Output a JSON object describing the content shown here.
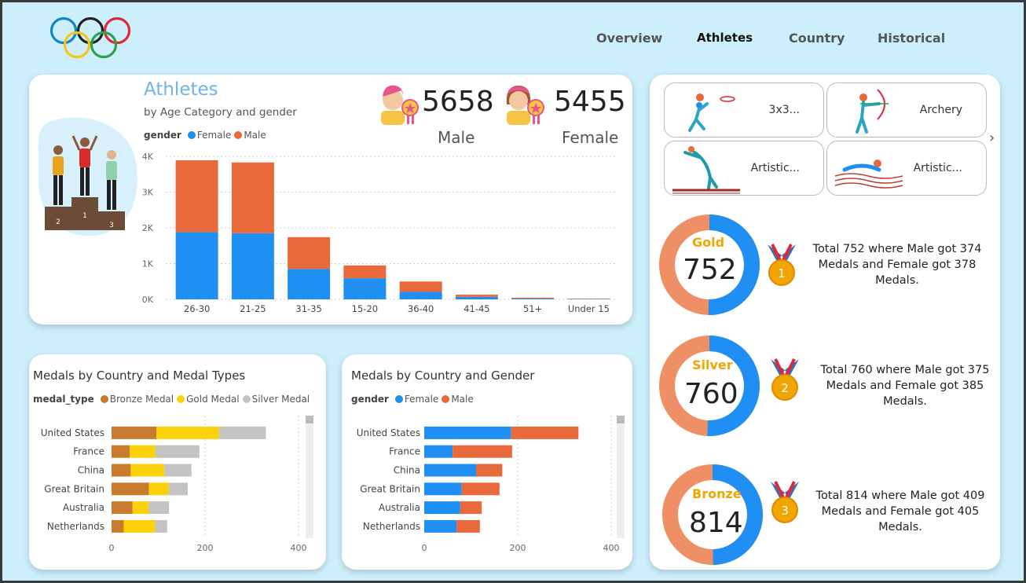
{
  "nav": {
    "items": [
      "Overview",
      "Athletes",
      "Country",
      "Historical"
    ],
    "active": "Athletes"
  },
  "athletes": {
    "title": "Athletes",
    "subtitle": "by Age Category and gender",
    "male_count": "5658",
    "male_label": "Male",
    "female_count": "5455",
    "female_label": "Female"
  },
  "sports": [
    {
      "label": "3x3...",
      "icon": "basketball-icon"
    },
    {
      "label": "Archery",
      "icon": "archery-icon"
    },
    {
      "label": "Artistic...",
      "icon": "gymnastics-icon"
    },
    {
      "label": "Artistic...",
      "icon": "swimming-icon"
    }
  ],
  "medals": [
    {
      "name": "Gold",
      "total": "752",
      "male": 374,
      "female": 378,
      "text": "Total 752 where Male got 374 Medals and Female got 378 Medals.",
      "label_color": "#f0a500"
    },
    {
      "name": "Silver",
      "total": "760",
      "male": 375,
      "female": 385,
      "text": "Total 760 where Male got 375 Medals and Female got 385 Medals.",
      "label_color": "#f0a500"
    },
    {
      "name": "Bronze",
      "total": "814",
      "male": 409,
      "female": 405,
      "text": "Total 814 where Male got 409 Medals and Female got 405 Medals.",
      "label_color": "#f0a500"
    }
  ],
  "colors": {
    "female": "#1f8ff3",
    "male": "#e8693a",
    "ring_male": "#ef8f66",
    "bronze": "#c97a2c",
    "gold": "#fdd20a",
    "silver": "#c3c3c3"
  },
  "chart_data": [
    {
      "type": "bar",
      "stacked": true,
      "title": "",
      "legend_title": "gender",
      "categories": [
        "26-30",
        "21-25",
        "31-35",
        "15-20",
        "36-40",
        "41-45",
        "51+",
        "Under 15"
      ],
      "series": [
        {
          "name": "Female",
          "values": [
            1880,
            1850,
            850,
            590,
            210,
            70,
            20,
            10
          ]
        },
        {
          "name": "Male",
          "values": [
            2010,
            1980,
            890,
            360,
            290,
            60,
            25,
            10
          ]
        }
      ],
      "ylim": [
        0,
        4000
      ],
      "yticks": [
        "0K",
        "1K",
        "2K",
        "3K",
        "4K"
      ],
      "grid": true,
      "legend_position": "top-left"
    },
    {
      "type": "bar",
      "orientation": "horizontal",
      "stacked": true,
      "title": "Medals by Country and Medal Types",
      "legend_title": "medal_type",
      "categories": [
        "United States",
        "France",
        "China",
        "Great Britain",
        "Australia",
        "Netherlands"
      ],
      "series": [
        {
          "name": "Bronze Medal",
          "values": [
            96,
            39,
            41,
            80,
            45,
            26
          ]
        },
        {
          "name": "Gold Medal",
          "values": [
            134,
            55,
            72,
            42,
            34,
            67
          ]
        },
        {
          "name": "Silver Medal",
          "values": [
            100,
            94,
            58,
            41,
            44,
            26
          ]
        }
      ],
      "xlim": [
        0,
        400
      ],
      "xticks": [
        "0",
        "200",
        "400"
      ],
      "legend_position": "top-left"
    },
    {
      "type": "bar",
      "orientation": "horizontal",
      "stacked": true,
      "title": "Medals by Country and Gender",
      "legend_title": "gender",
      "categories": [
        "United States",
        "France",
        "China",
        "Great Britain",
        "Australia",
        "Netherlands"
      ],
      "series": [
        {
          "name": "Female",
          "values": [
            186,
            61,
            111,
            80,
            77,
            69
          ]
        },
        {
          "name": "Male",
          "values": [
            144,
            127,
            56,
            81,
            46,
            50
          ]
        }
      ],
      "xlim": [
        0,
        400
      ],
      "xticks": [
        "0",
        "200",
        "400"
      ],
      "legend_position": "top-left"
    }
  ]
}
